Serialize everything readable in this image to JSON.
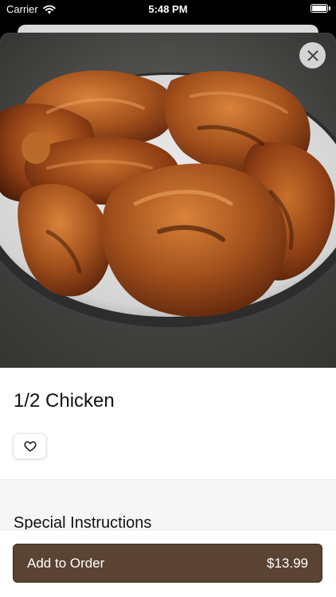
{
  "status_bar": {
    "carrier": "Carrier",
    "time": "5:48 PM"
  },
  "item": {
    "title": "1/2 Chicken",
    "image_icon": "chicken-photo"
  },
  "sections": {
    "special_instructions_heading": "Special Instructions"
  },
  "footer": {
    "add_label": "Add to Order",
    "price": "$13.99"
  },
  "colors": {
    "accent": "#5a4333"
  }
}
